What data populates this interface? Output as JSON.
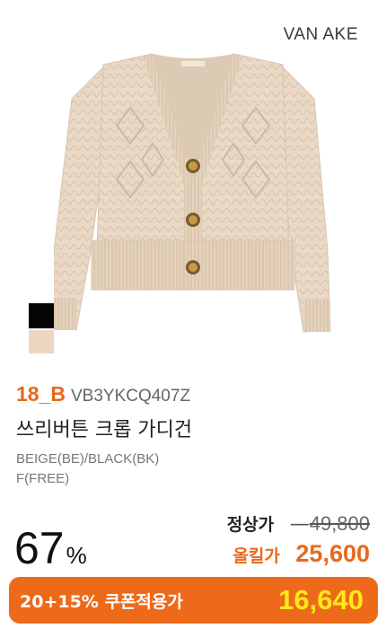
{
  "brand": "VAN AKE",
  "product": {
    "season": "18_B",
    "code": "VB3YKCQ407Z",
    "name": "쓰리버튼 크롭 가디건",
    "colors": "BEIGE(BE)/BLACK(BK)",
    "size": "F(FREE)"
  },
  "swatches": [
    {
      "name": "black",
      "color": "#050505"
    },
    {
      "name": "beige",
      "color": "#ecd8c2"
    }
  ],
  "pricing": {
    "discount_value": "67",
    "discount_unit": "%",
    "regular_label": "정상가",
    "regular_price": "49,800",
    "sale_label": "올킬가",
    "sale_price": "25,600",
    "coupon_label": "20+15% 쿠폰적용가",
    "coupon_price": "16,640"
  },
  "colors": {
    "accent": "#e8681c",
    "coupon_bg": "#ed6a1a",
    "coupon_price": "#ffe81a",
    "garment": "#e9d9c6"
  }
}
